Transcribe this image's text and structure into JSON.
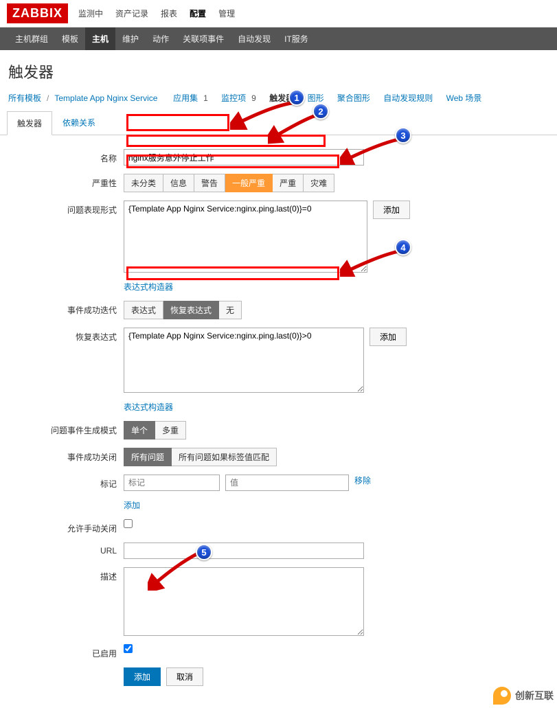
{
  "logo": "ZABBIX",
  "topnav": [
    "监测中",
    "资产记录",
    "报表",
    "配置",
    "管理"
  ],
  "topnav_active": 3,
  "subnav": [
    "主机群组",
    "模板",
    "主机",
    "维护",
    "动作",
    "关联项事件",
    "自动发现",
    "IT服务"
  ],
  "subnav_active": 2,
  "page_title": "触发器",
  "crumbs": {
    "all_templates": "所有模板",
    "template": "Template App Nginx Service",
    "items": [
      {
        "label": "应用集",
        "count": "1"
      },
      {
        "label": "监控项",
        "count": "9"
      },
      {
        "label": "触发器",
        "active": true
      },
      {
        "label": "图形"
      },
      {
        "label": "聚合图形"
      },
      {
        "label": "自动发现规则"
      },
      {
        "label": "Web 场景"
      }
    ]
  },
  "tabs": [
    {
      "label": "触发器",
      "active": true
    },
    {
      "label": "依赖关系"
    }
  ],
  "form": {
    "name_label": "名称",
    "name_value": "nginx服务意外停止工作",
    "severity_label": "严重性",
    "severities": [
      "未分类",
      "信息",
      "警告",
      "一般严重",
      "严重",
      "灾难"
    ],
    "severity_selected": 3,
    "expr_label": "问题表现形式",
    "expr_value": "{Template App Nginx Service:nginx.ping.last(0)}=0",
    "add_btn": "添加",
    "expr_builder": "表达式构造器",
    "event_iter_label": "事件成功迭代",
    "event_options": [
      "表达式",
      "恢复表达式",
      "无"
    ],
    "event_selected": 1,
    "recovery_label": "恢复表达式",
    "recovery_value": "{Template App Nginx Service:nginx.ping.last(0)}>0",
    "gen_mode_label": "问题事件生成模式",
    "gen_mode_options": [
      "单个",
      "多重"
    ],
    "gen_mode_selected": 0,
    "ok_close_label": "事件成功关闭",
    "ok_close_options": [
      "所有问题",
      "所有问题如果标签值匹配"
    ],
    "ok_close_selected": 0,
    "tags_label": "标记",
    "tag_placeholder": "标记",
    "value_placeholder": "值",
    "remove": "移除",
    "add_link": "添加",
    "manual_close_label": "允许手动关闭",
    "url_label": "URL",
    "desc_label": "描述",
    "enabled_label": "已启用",
    "submit": "添加",
    "cancel": "取消"
  },
  "annotations": {
    "b1": "1",
    "b2": "2",
    "b3": "3",
    "b4": "4",
    "b5": "5"
  },
  "watermark": "创新互联"
}
